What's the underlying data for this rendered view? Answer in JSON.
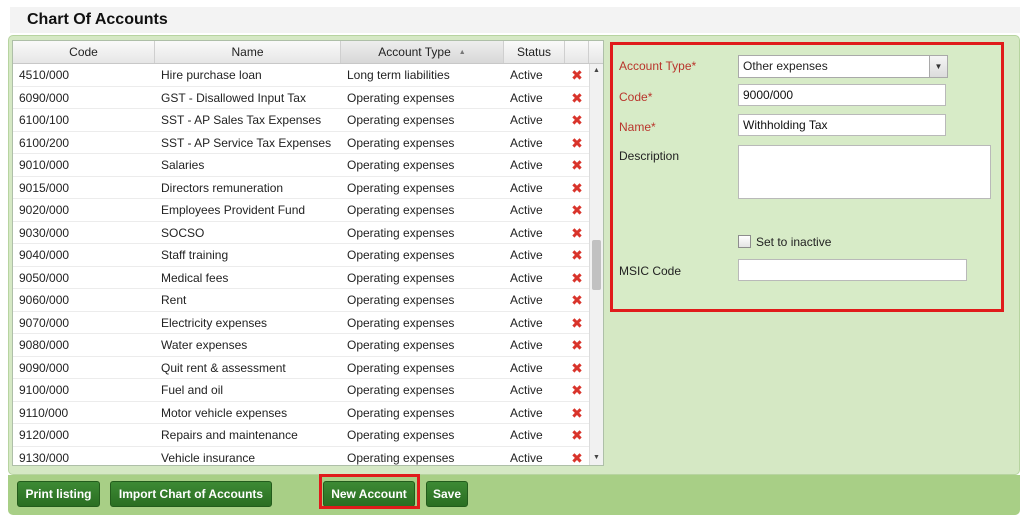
{
  "page": {
    "title": "Chart Of Accounts"
  },
  "grid": {
    "columns": {
      "code": "Code",
      "name": "Name",
      "account_type": "Account Type",
      "status": "Status"
    },
    "rows": [
      {
        "code": "4510/000",
        "name": "Hire purchase loan",
        "type": "Long term liabilities",
        "status": "Active"
      },
      {
        "code": "6090/000",
        "name": "GST - Disallowed Input Tax",
        "type": "Operating expenses",
        "status": "Active"
      },
      {
        "code": "6100/100",
        "name": "SST - AP Sales Tax Expenses",
        "type": "Operating expenses",
        "status": "Active"
      },
      {
        "code": "6100/200",
        "name": "SST - AP Service Tax Expenses",
        "type": "Operating expenses",
        "status": "Active"
      },
      {
        "code": "9010/000",
        "name": "Salaries",
        "type": "Operating expenses",
        "status": "Active"
      },
      {
        "code": "9015/000",
        "name": "Directors remuneration",
        "type": "Operating expenses",
        "status": "Active"
      },
      {
        "code": "9020/000",
        "name": "Employees Provident Fund",
        "type": "Operating expenses",
        "status": "Active"
      },
      {
        "code": "9030/000",
        "name": "SOCSO",
        "type": "Operating expenses",
        "status": "Active"
      },
      {
        "code": "9040/000",
        "name": "Staff training",
        "type": "Operating expenses",
        "status": "Active"
      },
      {
        "code": "9050/000",
        "name": "Medical fees",
        "type": "Operating expenses",
        "status": "Active"
      },
      {
        "code": "9060/000",
        "name": "Rent",
        "type": "Operating expenses",
        "status": "Active"
      },
      {
        "code": "9070/000",
        "name": "Electricity expenses",
        "type": "Operating expenses",
        "status": "Active"
      },
      {
        "code": "9080/000",
        "name": "Water expenses",
        "type": "Operating expenses",
        "status": "Active"
      },
      {
        "code": "9090/000",
        "name": "Quit rent & assessment",
        "type": "Operating expenses",
        "status": "Active"
      },
      {
        "code": "9100/000",
        "name": "Fuel and oil",
        "type": "Operating expenses",
        "status": "Active"
      },
      {
        "code": "9110/000",
        "name": "Motor vehicle expenses",
        "type": "Operating expenses",
        "status": "Active"
      },
      {
        "code": "9120/000",
        "name": "Repairs and maintenance",
        "type": "Operating expenses",
        "status": "Active"
      },
      {
        "code": "9130/000",
        "name": "Vehicle insurance",
        "type": "Operating expenses",
        "status": "Active"
      }
    ],
    "delete_glyph": "✖",
    "sort_glyph": "▲",
    "scroll_up_glyph": "▲",
    "scroll_down_glyph": "▼",
    "scroll_fraction": 0.5
  },
  "form": {
    "account_type_label": "Account Type*",
    "account_type_value": "Other expenses",
    "select_glyph": "▼",
    "code_label": "Code*",
    "code_value": "9000/000",
    "name_label": "Name*",
    "name_value": "Withholding Tax",
    "description_label": "Description",
    "description_value": "",
    "inactive_label": "Set to inactive",
    "inactive_checked": false,
    "msic_label": "MSIC Code",
    "msic_value": ""
  },
  "toolbar": {
    "print_label": "Print listing",
    "import_label": "Import Chart of Accounts",
    "new_label": "New Account",
    "save_label": "Save"
  },
  "colors": {
    "panel_green": "#d5e8c4",
    "button_green": "#2f7a27",
    "highlight_red": "#e01b1b",
    "required_label": "#b9352c"
  }
}
